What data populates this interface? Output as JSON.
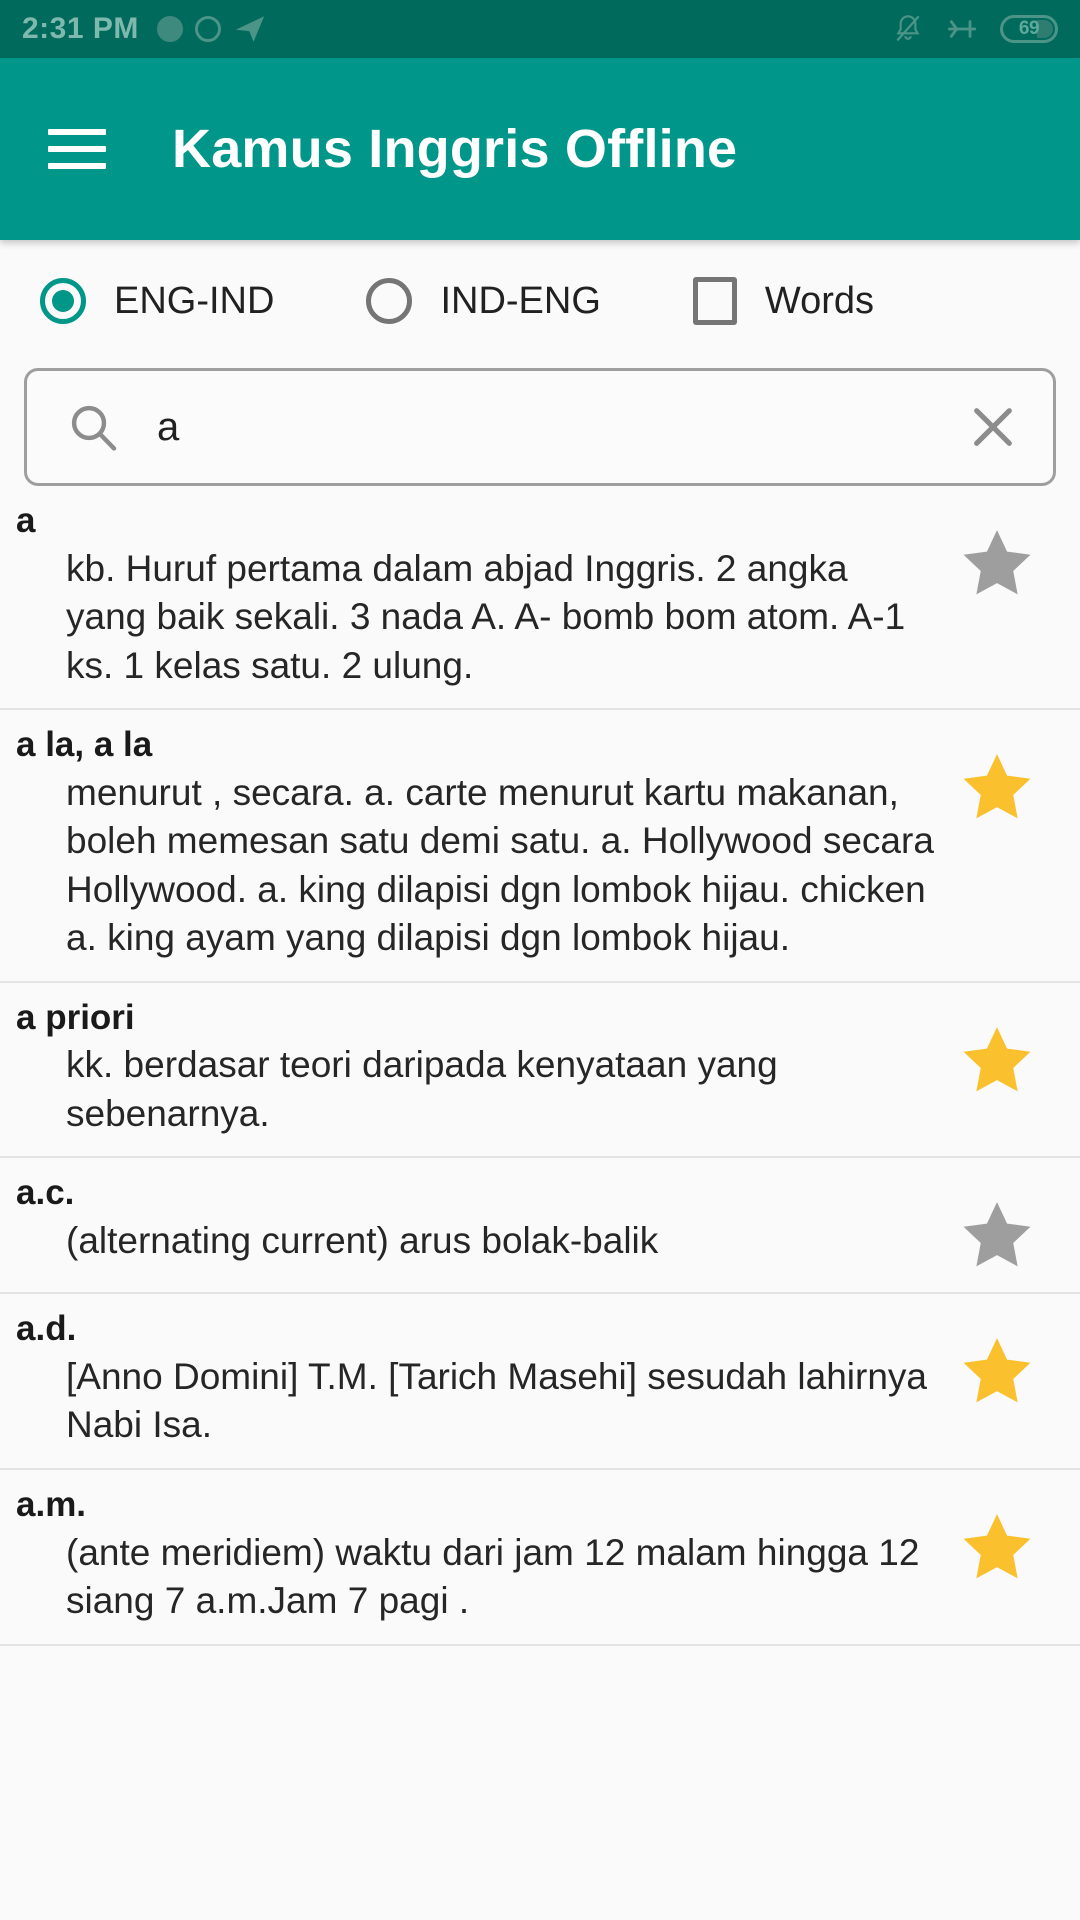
{
  "status_bar": {
    "time": "2:31 PM",
    "left_icons": [
      "circle-filled-icon",
      "circle-ring-icon",
      "telegram-send-icon"
    ],
    "right_icons": [
      "bell-muted-icon",
      "airplane-mode-icon"
    ],
    "battery_level": "69",
    "background_color": "#006b5c",
    "foreground_color": "#7fb9ae"
  },
  "app_bar": {
    "menu_icon": "hamburger-menu-icon",
    "title": "Kamus Inggris Offline",
    "background_color": "#00968a",
    "title_color": "#ffffff"
  },
  "options": {
    "items": [
      {
        "type": "radio",
        "label": "ENG-IND",
        "checked": true
      },
      {
        "type": "radio",
        "label": "IND-ENG",
        "checked": false
      },
      {
        "type": "checkbox",
        "label": "Words",
        "checked": false
      }
    ],
    "accent_color": "#009688",
    "inactive_color": "#757575"
  },
  "search": {
    "icon": "search-icon",
    "value": "a",
    "placeholder": "",
    "clear_icon": "close-icon"
  },
  "results": {
    "entries": [
      {
        "word": "a",
        "definition": "kb. Huruf pertama dalam abjad Inggris. 2 angka yang baik sekali. 3 nada  A.   A- bomb bom atom.  A-1 ks. 1 kelas satu. 2 ulung.",
        "starred": false
      },
      {
        "word": "a la, a la",
        "definition": "menurut , secara. a. carte menurut kartu makanan, boleh memesan satu demi satu. a. Hollywood secara Hollywood. a. king dilapisi dgn lombok hijau. chicken a. king ayam yang dilapisi dgn lombok hijau.",
        "starred": true
      },
      {
        "word": "a priori",
        "definition": "kk. berdasar teori daripada kenyataan yang sebenarnya.",
        "starred": true
      },
      {
        "word": "a.c.",
        "definition": "(alternating current) arus bolak-balik",
        "starred": false
      },
      {
        "word": "a.d.",
        "definition": "[Anno Domini] T.M. [Tarich Masehi] sesudah lahirnya Nabi Isa.",
        "starred": true
      },
      {
        "word": "a.m.",
        "definition": "(ante meridiem) waktu dari jam 12 malam hingga 12 siang 7 a.m.Jam 7 pagi .",
        "starred": true
      }
    ],
    "star_on_color": "#fbc02d",
    "star_off_color": "#9e9e9e"
  }
}
